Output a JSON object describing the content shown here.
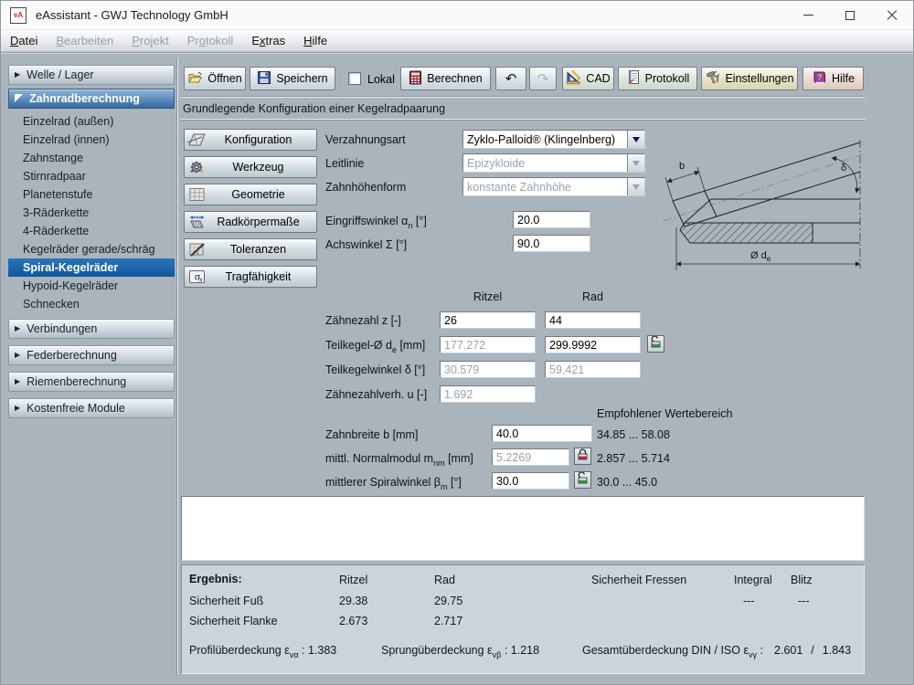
{
  "titlebar": {
    "icon_text": "eA",
    "title": "eAssistant - GWJ Technology GmbH"
  },
  "icons": {
    "collapsed_arrow": "▶",
    "undo": "↶",
    "redo": "↷",
    "sigma": "σ",
    "sigma_sub": "x",
    "help_qmark": "?"
  },
  "menubar": {
    "items": [
      {
        "pre": "",
        "key": "D",
        "post": "atei",
        "enabled": true
      },
      {
        "pre": "",
        "key": "B",
        "post": "earbeiten",
        "enabled": false
      },
      {
        "pre": "",
        "key": "P",
        "post": "rojekt",
        "enabled": false
      },
      {
        "pre": "Pr",
        "key": "o",
        "post": "tokoll",
        "enabled": false
      },
      {
        "pre": "E",
        "key": "x",
        "post": "tras",
        "enabled": true
      },
      {
        "pre": "",
        "key": "H",
        "post": "ilfe",
        "enabled": true
      }
    ]
  },
  "toolbar": {
    "open_label": "Öffnen",
    "save_label": "Speichern",
    "local_label": "Lokal",
    "local_checked": false,
    "calculate_label": "Berechnen",
    "cad_label": "CAD",
    "protocol_label": "Protokoll",
    "settings_label": "Einstellungen",
    "help_label": "Hilfe"
  },
  "sidebar": {
    "groups": [
      "Welle / Lager",
      "Zahnradberechnung",
      "Verbindungen",
      "Federberechnung",
      "Riemenberechnung",
      "Kostenfreie Module"
    ],
    "zahnrad_items": [
      "Einzelrad (außen)",
      "Einzelrad (innen)",
      "Zahnstange",
      "Stirnradpaar",
      "Planetenstufe",
      "3-Räderkette",
      "4-Räderkette",
      "Kegelräder gerade/schräg",
      "Spiral-Kegelräder",
      "Hypoid-Kegelräder",
      "Schnecken"
    ],
    "selected_item": "Spiral-Kegelräder"
  },
  "page": {
    "section_title": "Grundlegende Konfiguration einer Kegelradpaarung"
  },
  "nav_buttons": [
    "Konfiguration",
    "Werkzeug",
    "Geometrie",
    "Radkörpermaße",
    "Toleranzen",
    "Tragfähigkeit"
  ],
  "form": {
    "verzahnungsart_label": "Verzahnungsart",
    "verzahnungsart_value": "Zyklo-Palloid® (Klingelnberg)",
    "leitlinie_label": "Leitlinie",
    "leitlinie_value": "Epizykloide",
    "zahnhoehenform_label": "Zahnhöhenform",
    "zahnhoehenform_value": "konstante Zahnhöhe",
    "eingriffswinkel": {
      "pre": "Eingriffswinkel α",
      "sub": "n",
      "post": " [°]",
      "value": "20.0"
    },
    "achswinkel": {
      "pre": "Achswinkel Σ [°]",
      "value": "90.0"
    }
  },
  "gear_table": {
    "col1": "Ritzel",
    "col2": "Rad",
    "zaehnezahl": {
      "pre": "Zähnezahl z [-]",
      "ritzel": "26",
      "rad": "44"
    },
    "teilkegel": {
      "pre": "Teilkegel-Ø d",
      "sub": "e",
      "post": " [mm]",
      "ritzel": "177.272",
      "rad": "299.9992"
    },
    "teilkegelwinkel": {
      "pre": "Teilkegelwinkel δ [°]",
      "ritzel": "30.579",
      "rad": "59.421"
    },
    "zaehnezahlverh": {
      "pre": "Zähnezahlverh. u [-]",
      "value": "1.692"
    }
  },
  "dimensions": {
    "recommended_header": "Empfohlener Wertebereich",
    "zahnbreite": {
      "pre": "Zahnbreite b [mm]",
      "value": "40.0",
      "range": "34.85 ... 58.08"
    },
    "normalmodul": {
      "pre": "mittl. Normalmodul m",
      "sub": "nm",
      "post": " [mm]",
      "value": "5.2269",
      "range": "2.857 ... 5.714"
    },
    "spiralwinkel": {
      "pre": "mittlerer Spiralwinkel β",
      "sub": "m",
      "post": " [°]",
      "value": "30.0",
      "range": "30.0 ... 45.0"
    }
  },
  "results": {
    "title": "Ergebnis:",
    "col_ritzel": "Ritzel",
    "col_rad": "Rad",
    "col_fressen": "Sicherheit Fressen",
    "col_integral": "Integral",
    "col_blitz": "Blitz",
    "fuss": {
      "label": "Sicherheit Fuß",
      "ritzel": "29.38",
      "rad": "29.75",
      "integral": "---",
      "blitz": "---"
    },
    "flanke": {
      "label": "Sicherheit Flanke",
      "ritzel": "2.673",
      "rad": "2.717"
    },
    "profil": {
      "pre": "Profilüberdeckung ε",
      "sub": "vα",
      "colon": ":",
      "value": "1.383"
    },
    "sprung": {
      "pre": "Sprungüberdeckung ε",
      "sub": "vβ",
      "colon": ":",
      "value": "1.218"
    },
    "gesamt": {
      "pre": "Gesamtüberdeckung DIN / ISO ε",
      "sub": "vγ",
      "colon": ":",
      "din": "2.601",
      "slash": "/",
      "iso": "1.843"
    }
  },
  "drawing": {
    "label_b": "b",
    "label_delta": "δ",
    "label_de": "Ø d",
    "label_de_sub": "e"
  },
  "colors": {
    "selection_blue": "#1257a0",
    "group_header_blue_top": "#8fb5d8",
    "group_header_blue_bottom": "#35689c",
    "lock_open_green": "#27a23d",
    "lock_closed_red": "#c42430",
    "background": "#a9b4bd",
    "results_background": "#ccd4da"
  }
}
